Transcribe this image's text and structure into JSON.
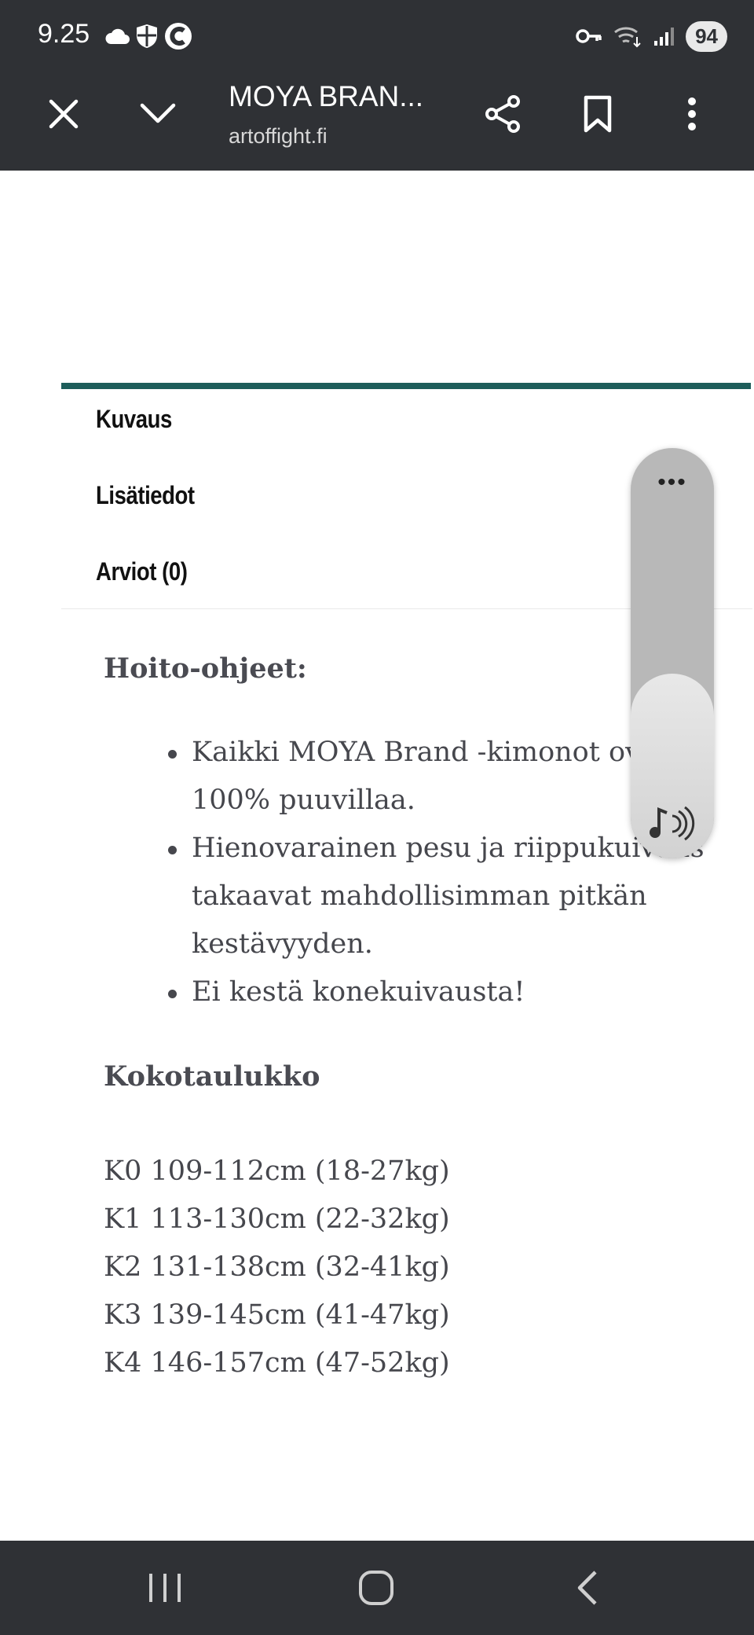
{
  "status_bar": {
    "time": "9.25",
    "battery": "94",
    "icons_left": [
      "cloud-icon",
      "shield-icon",
      "app-c-icon"
    ],
    "icons_right": [
      "vpn-key-icon",
      "wifi-icon",
      "signal-icon"
    ]
  },
  "toolbar": {
    "title": "MOYA BRAN...",
    "url": "artoffight.fi",
    "buttons": [
      "close-icon",
      "chevron-down-icon",
      "share-icon",
      "bookmark-icon",
      "more-vert-icon"
    ]
  },
  "tabs": [
    {
      "label": "Kuvaus"
    },
    {
      "label": "Lisätiedot"
    },
    {
      "label": "Arviot (0)"
    }
  ],
  "care": {
    "heading": "Hoito-ohjeet:",
    "items": [
      "Kaikki MOYA Brand -kimonot ovat 100% puuvillaa.",
      "Hienovarainen pesu ja riippukuivaus takaavat mahdollisimman pitkän kestävyyden.",
      "Ei kestä konekuivausta!"
    ]
  },
  "sizes": {
    "heading": "Kokotaulukko",
    "rows": [
      "K0 109-112cm (18-27kg)",
      "K1 113-130cm (22-32kg)",
      "K2 131-138cm (32-41kg)",
      "K3 139-145cm (41-47kg)",
      "K4 146-157cm (47-52kg)"
    ]
  },
  "volume_overlay": {
    "menu": "•••",
    "level": 0.45,
    "icon": "media-volume-icon"
  },
  "navbar": {
    "buttons": [
      "recent-apps-icon",
      "home-icon",
      "back-icon"
    ]
  },
  "colors": {
    "bars": "#2f3135",
    "accent_rule": "#1d5d5a",
    "body_text": "#46474d"
  }
}
